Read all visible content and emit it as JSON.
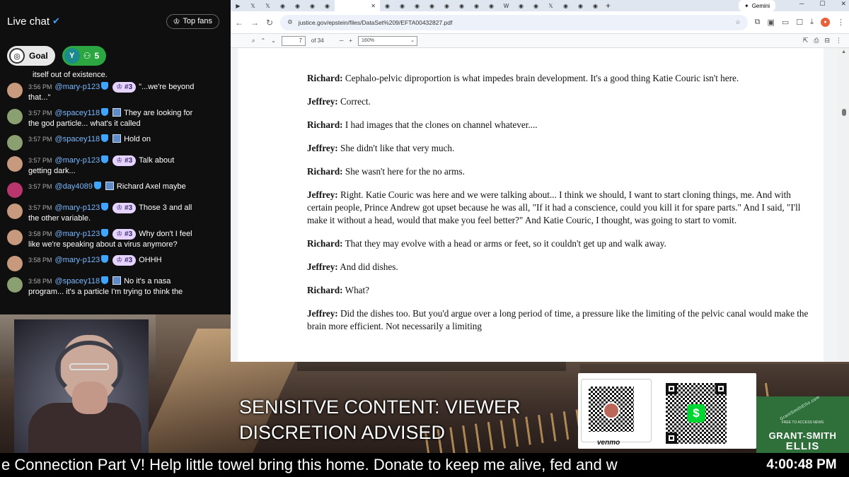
{
  "chat": {
    "title": "Live chat",
    "top_fans_label": "Top fans",
    "goal_label": "Goal",
    "y_avatar": "Y",
    "y_count": "5",
    "continuation_top": "itself out of existence.",
    "messages": [
      {
        "time": "3:56 PM",
        "user": "@mary-p123",
        "badge": "#3",
        "text": "\"...we're beyond",
        "cont": "that...\"",
        "avatar_color": "#c79a7e"
      },
      {
        "time": "3:57 PM",
        "user": "@spacey118",
        "badge": "",
        "text": "They are looking for",
        "cont": "the god particle... what's it called",
        "avatar_color": "#8aa070"
      },
      {
        "time": "3:57 PM",
        "user": "@spacey118",
        "badge": "",
        "text": "Hold on",
        "cont": "",
        "avatar_color": "#8aa070"
      },
      {
        "time": "3:57 PM",
        "user": "@mary-p123",
        "badge": "#3",
        "text": "Talk about",
        "cont": "getting dark...",
        "avatar_color": "#c79a7e"
      },
      {
        "time": "3:57 PM",
        "user": "@day4089",
        "badge": "",
        "text": "Richard Axel maybe",
        "cont": "",
        "avatar_color": "#b8356e"
      },
      {
        "time": "3:57 PM",
        "user": "@mary-p123",
        "badge": "#3",
        "text": "Those 3 and all",
        "cont": "the other variable.",
        "avatar_color": "#c79a7e"
      },
      {
        "time": "3:58 PM",
        "user": "@mary-p123",
        "badge": "#3",
        "text": "Why don't I feel",
        "cont": "like we're speaking about a virus anymore?",
        "avatar_color": "#c79a7e"
      },
      {
        "time": "3:58 PM",
        "user": "@mary-p123",
        "badge": "#3",
        "text": "OHHH",
        "cont": "",
        "avatar_color": "#c79a7e"
      },
      {
        "time": "3:58 PM",
        "user": "@spacey118",
        "badge": "",
        "text": "No it's a nasa",
        "cont": "program... it's a particle I'm trying to think the",
        "avatar_color": "#8aa070"
      }
    ]
  },
  "browser": {
    "gemini_label": "Gemini",
    "url": "justice.gov/epstein/files/DataSet%209/EFTA00432827.pdf",
    "pdf": {
      "page": "7",
      "of_pages": "of 34",
      "zoom": "160%"
    },
    "transcript": [
      {
        "speaker": "Richard:",
        "text": "Cephalo-pelvic diproportion is what impedes brain development. It's a good thing Katie Couric isn't here."
      },
      {
        "speaker": "Jeffrey:",
        "text": "Correct."
      },
      {
        "speaker": "Richard:",
        "text": "I had images that the clones on channel whatever...."
      },
      {
        "speaker": "Jeffrey:",
        "text": "She didn't like that very much."
      },
      {
        "speaker": "Richard:",
        "text": "She wasn't here for the no arms."
      },
      {
        "speaker": "Jeffrey:",
        "text": "Right. Katie Couric was here and we were talking about... I think we should, I want to start cloning things, me. And with certain people, Prince Andrew got upset because he was all, \"If it had a conscience, could you kill it for spare parts.\" And I said, \"I'll make it without a head, would that make you feel better?\" And Katie Couric, I thought, was going to start to vomit."
      },
      {
        "speaker": "Richard:",
        "text": "That they may evolve with a head or arms or feet, so it couldn't get up and walk away."
      },
      {
        "speaker": "Jeffrey:",
        "text": "And did dishes."
      },
      {
        "speaker": "Richard:",
        "text": "What?"
      },
      {
        "speaker": "Jeffrey:",
        "text": "Did the dishes too. But you'd argue over a long period of time, a pressure like the limiting of the pelvic canal would make the brain more efficient. Not necessarily a limiting"
      }
    ]
  },
  "overlay": {
    "warning_line1": "SENISITVE CONTENT: VIEWER",
    "warning_line2": "DISCRETION ADVISED",
    "venmo_label": "venmo",
    "cash_symbol": "$",
    "brand_arc": "GrantSmithEllis.com",
    "brand_small": "FREE TO ACCESS NEWS",
    "brand_name1": "GRANT-SMITH",
    "brand_name2": "ELLIS",
    "ticker": "e Connection Part V! Help little towel bring this home. Donate to keep me alive, fed and w",
    "clock": "4:00:48 PM"
  }
}
